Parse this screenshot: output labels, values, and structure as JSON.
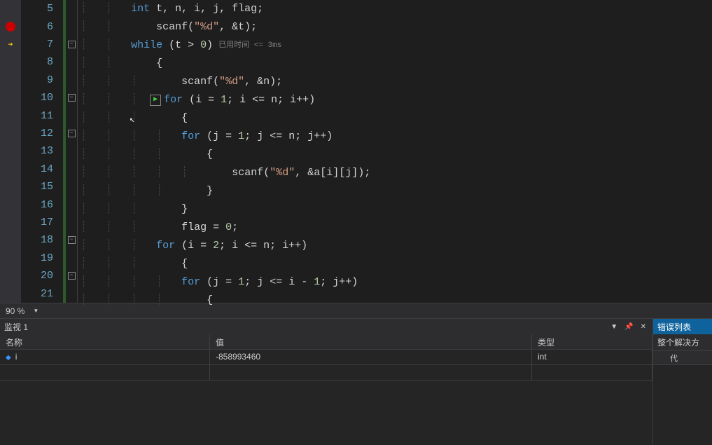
{
  "editor": {
    "line_start": 5,
    "lines": [
      "            int t, n, i, j, flag;",
      "            scanf(\"%d\", &t);",
      "            while (t > 0)",
      "            {",
      "                scanf(\"%d\", &n);",
      "                for (i = 1; i <= n; i++)",
      "                {",
      "                    for (j = 1; j <= n; j++)",
      "                    {",
      "                        scanf(\"%d\", &a[i][j]);",
      "                    }",
      "                }",
      "                flag = 0;",
      "                for (i = 2; i <= n; i++)",
      "                {",
      "                    for (j = 1; j <= i - 1; j++)",
      "                    {"
    ],
    "timing_label": "已用时间 <= 3ms",
    "line_numbers": [
      "5",
      "6",
      "7",
      "8",
      "9",
      "10",
      "11",
      "12",
      "13",
      "14",
      "15",
      "16",
      "17",
      "18",
      "19",
      "20",
      "21"
    ]
  },
  "zoom": {
    "value": "90 %"
  },
  "watch": {
    "title": "监视 1",
    "columns": {
      "name": "名称",
      "value": "值",
      "type": "类型"
    },
    "rows": [
      {
        "name": "i",
        "value": "-858993460",
        "type": "int"
      }
    ]
  },
  "error_panel": {
    "title": "错误列表",
    "toolbar": "整个解决方",
    "col1": "代"
  }
}
